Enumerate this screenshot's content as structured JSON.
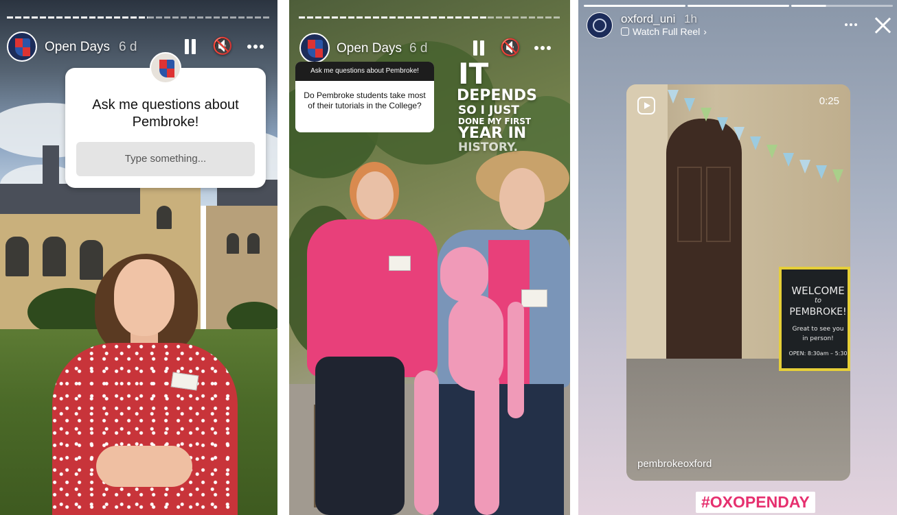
{
  "panel1": {
    "account": "Open Days",
    "age": "6 d",
    "question_sticker": {
      "title": "Ask me questions about Pembroke!",
      "placeholder": "Type something..."
    },
    "icons": [
      "pause-icon",
      "mute-icon",
      "more-icon"
    ]
  },
  "panel2": {
    "account": "Open Days",
    "age": "6 d",
    "answer_sticker": {
      "header": "Ask me questions about Pembroke!",
      "question": "Do Pembroke students take most of their tutorials in the College?"
    },
    "overlay_text": {
      "line1": "IT",
      "line2": "DEPENDS",
      "line3": "SO I JUST",
      "line4": "DONE MY FIRST",
      "line5": "YEAR IN",
      "line6": "HISTORY."
    },
    "icons": [
      "pause-icon",
      "mute-icon",
      "more-icon"
    ]
  },
  "panel3": {
    "account": "oxford_uni",
    "age": "1h",
    "watch_link": "Watch Full Reel",
    "reel": {
      "duration": "0:25",
      "username": "pembrokeoxford",
      "sign_lines": [
        "WELCOME",
        "to",
        "PEMBROKE!",
        "Great to see you",
        "in person!",
        "OPEN: 8:30am – 5:30"
      ]
    },
    "hashtag": "#OXOPENDAY",
    "icons": [
      "more-icon",
      "close-icon",
      "reel-icon"
    ]
  },
  "colors": {
    "hashtag": "#e6306f",
    "chalkboard_frame": "#e6cf38",
    "pink_shirt": "#e8407a",
    "dress": "#c8343a"
  }
}
